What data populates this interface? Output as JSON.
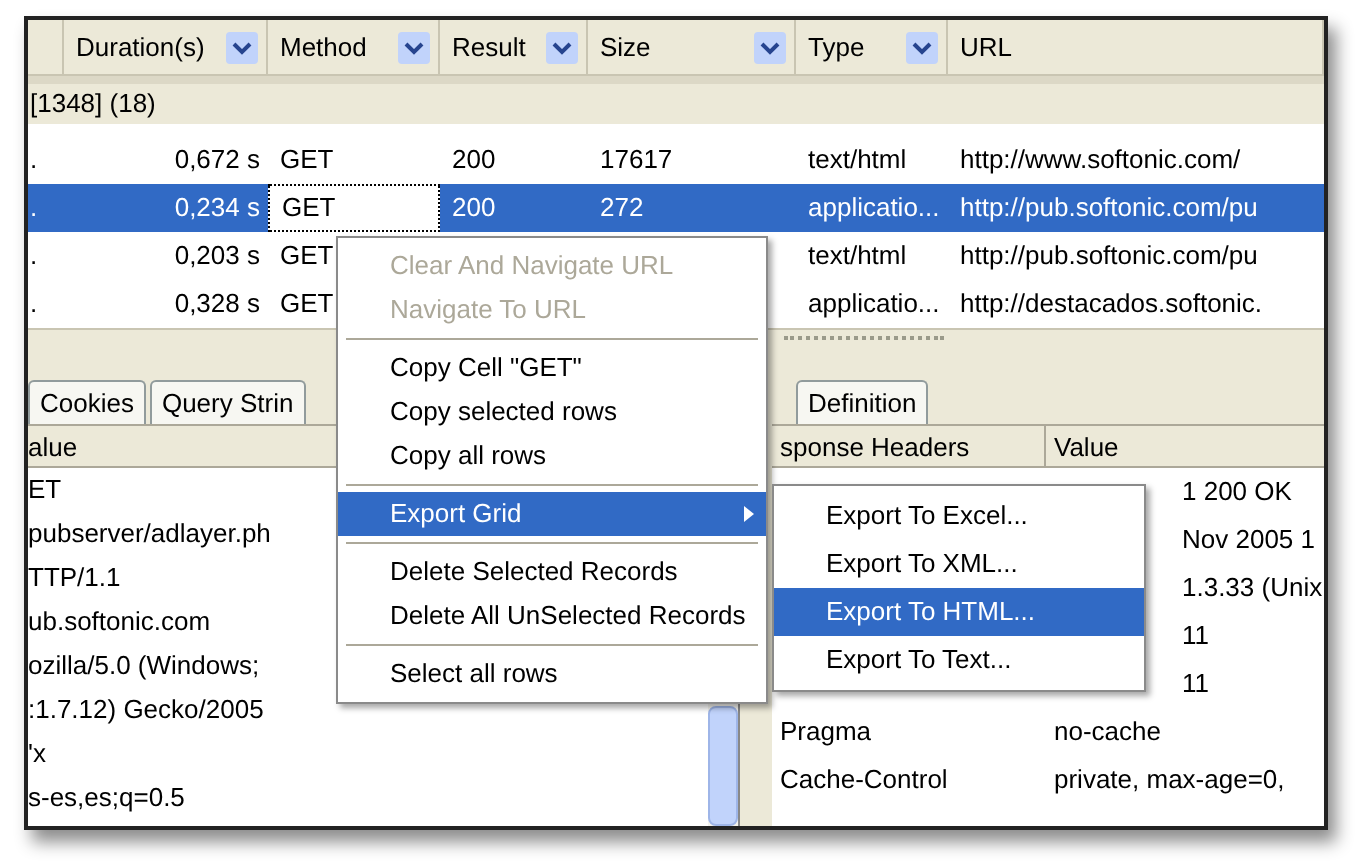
{
  "columns": [
    {
      "label": "Duration(s)",
      "filter": true
    },
    {
      "label": "Method",
      "filter": true
    },
    {
      "label": "Result",
      "filter": true
    },
    {
      "label": "Size",
      "filter": true
    },
    {
      "label": "Type",
      "filter": true
    },
    {
      "label": "URL",
      "filter": false
    }
  ],
  "group_row": "[1348] (18)",
  "rows": [
    {
      "marker": ".",
      "duration": "0,672 s",
      "method": "GET",
      "result": "200",
      "size": "17617",
      "type": "text/html",
      "url": "http://www.softonic.com/",
      "selected": false
    },
    {
      "marker": ".",
      "duration": "0,234 s",
      "method": "GET",
      "result": "200",
      "size": "272",
      "type": "applicatio...",
      "url": "http://pub.softonic.com/pu",
      "selected": true
    },
    {
      "marker": ".",
      "duration": "0,203 s",
      "method": "GET",
      "type": "text/html",
      "url": "http://pub.softonic.com/pu",
      "selected": false
    },
    {
      "marker": ".",
      "duration": "0,328 s",
      "method": "GET",
      "type": "applicatio...",
      "url": "http://destacados.softonic.",
      "selected": false
    }
  ],
  "left_tabs": [
    {
      "label": "Cookies",
      "selected": false
    },
    {
      "label": "Query Strin",
      "selected": false
    }
  ],
  "right_tabs": [
    {
      "label": "Definition",
      "selected": false
    }
  ],
  "left_pane": {
    "header": "alue",
    "lines": [
      "ET",
      "pubserver/adlayer.ph",
      "TTP/1.1",
      "ub.softonic.com",
      "ozilla/5.0 (Windows;",
      ":1.7.12) Gecko/2005",
      "'x",
      "s-es,es;q=0.5"
    ]
  },
  "right_pane": {
    "headers": [
      "sponse Headers",
      "Value"
    ],
    "rows": [
      {
        "value": "1 200 OK"
      },
      {
        "value": "Nov 2005 1"
      },
      {
        "value": "1.3.33 (Unix"
      },
      {
        "value": "11"
      },
      {
        "value": "11"
      },
      {
        "name": "Pragma",
        "value": "no-cache"
      },
      {
        "name": "Cache-Control",
        "value": "private, max-age=0,"
      }
    ]
  },
  "context_menu": [
    {
      "kind": "item",
      "label": "Clear And Navigate URL",
      "disabled": true,
      "selected": false,
      "submenu": false
    },
    {
      "kind": "item",
      "label": "Navigate To URL",
      "disabled": true,
      "selected": false,
      "submenu": false
    },
    {
      "kind": "separator"
    },
    {
      "kind": "item",
      "label": "Copy Cell \"GET\"",
      "disabled": false,
      "selected": false,
      "submenu": false
    },
    {
      "kind": "item",
      "label": "Copy selected rows",
      "disabled": false,
      "selected": false,
      "submenu": false
    },
    {
      "kind": "item",
      "label": "Copy all rows",
      "disabled": false,
      "selected": false,
      "submenu": false
    },
    {
      "kind": "separator"
    },
    {
      "kind": "item",
      "label": "Export Grid",
      "disabled": false,
      "selected": true,
      "submenu": true
    },
    {
      "kind": "separator"
    },
    {
      "kind": "item",
      "label": "Delete Selected Records",
      "disabled": false,
      "selected": false,
      "submenu": false
    },
    {
      "kind": "item",
      "label": "Delete All UnSelected Records",
      "disabled": false,
      "selected": false,
      "submenu": false
    },
    {
      "kind": "separator"
    },
    {
      "kind": "item",
      "label": "Select all rows",
      "disabled": false,
      "selected": false,
      "submenu": false
    }
  ],
  "submenu": [
    {
      "label": "Export To Excel...",
      "selected": false
    },
    {
      "label": "Export To XML...",
      "selected": false
    },
    {
      "label": "Export To HTML...",
      "selected": true
    },
    {
      "label": "Export To Text...",
      "selected": false
    }
  ]
}
